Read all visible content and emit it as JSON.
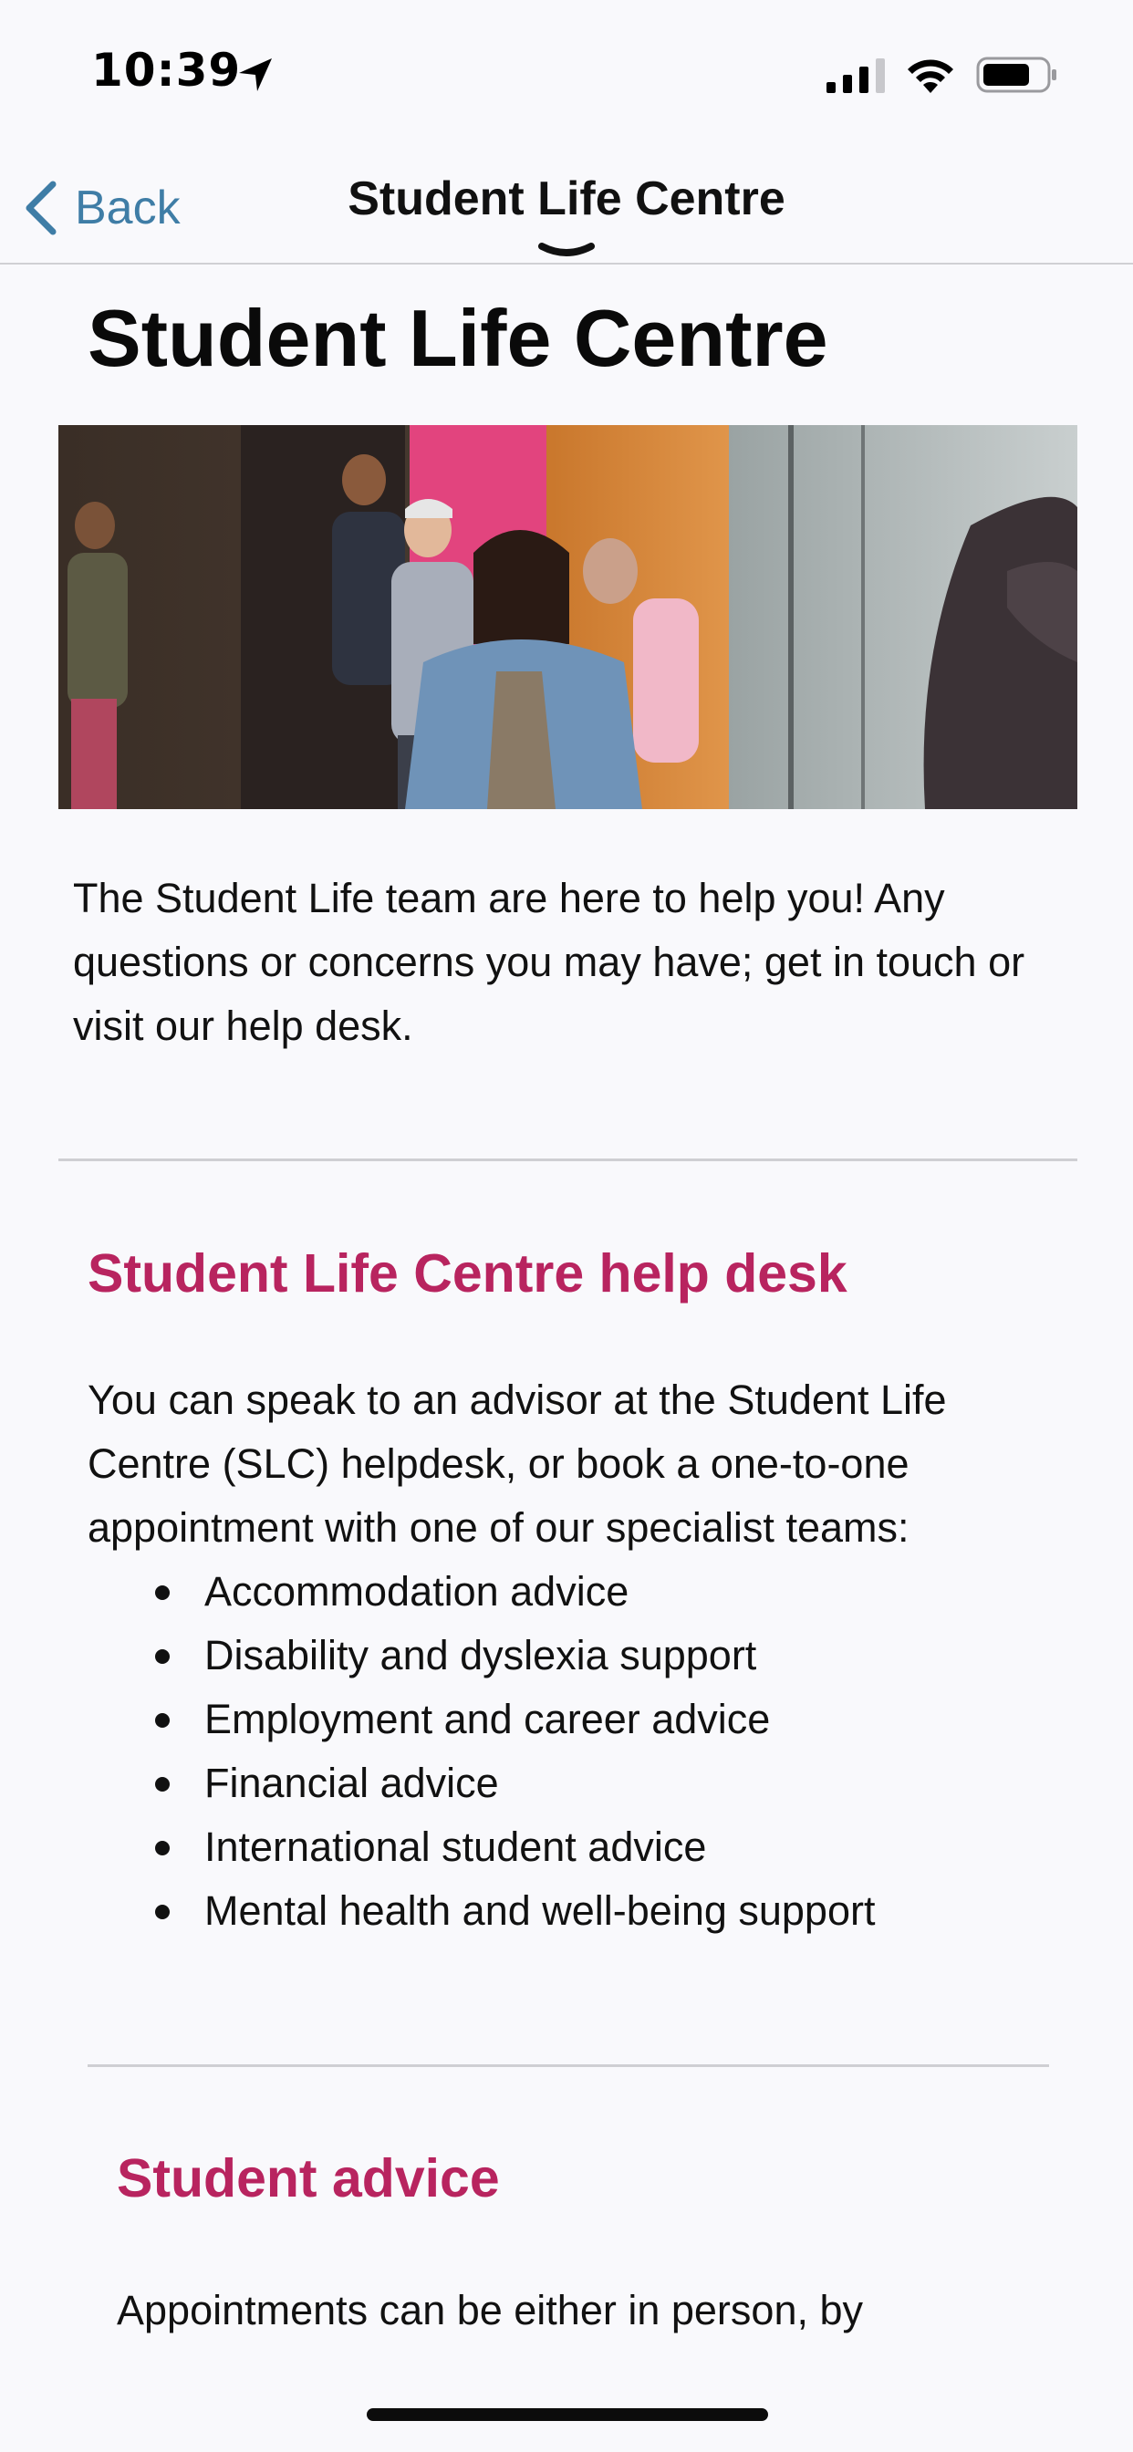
{
  "status": {
    "time": "10:39"
  },
  "nav": {
    "back_label": "Back",
    "title": "Student Life Centre"
  },
  "page": {
    "title": "Student Life Centre",
    "hero_image_alt": "Students walking",
    "intro": "The Student Life team are here to help you! Any questions or concerns you may have; get in touch or visit our help desk."
  },
  "helpdesk": {
    "heading": "Student Life Centre help desk",
    "text": "You can speak to an advisor at the Student Life Centre (SLC) helpdesk, or book a one-to-one appointment with one of our specialist teams:",
    "services": [
      "Accommodation advice",
      "Disability and dyslexia support",
      "Employment and career advice",
      "Financial advice",
      "International student advice",
      "Mental health and well-being support"
    ]
  },
  "advice": {
    "heading": "Student advice",
    "text": "Appointments can be either in person, by"
  },
  "colors": {
    "accent": "#b8245f",
    "link": "#3f7da6",
    "background": "#f9f9fc"
  }
}
